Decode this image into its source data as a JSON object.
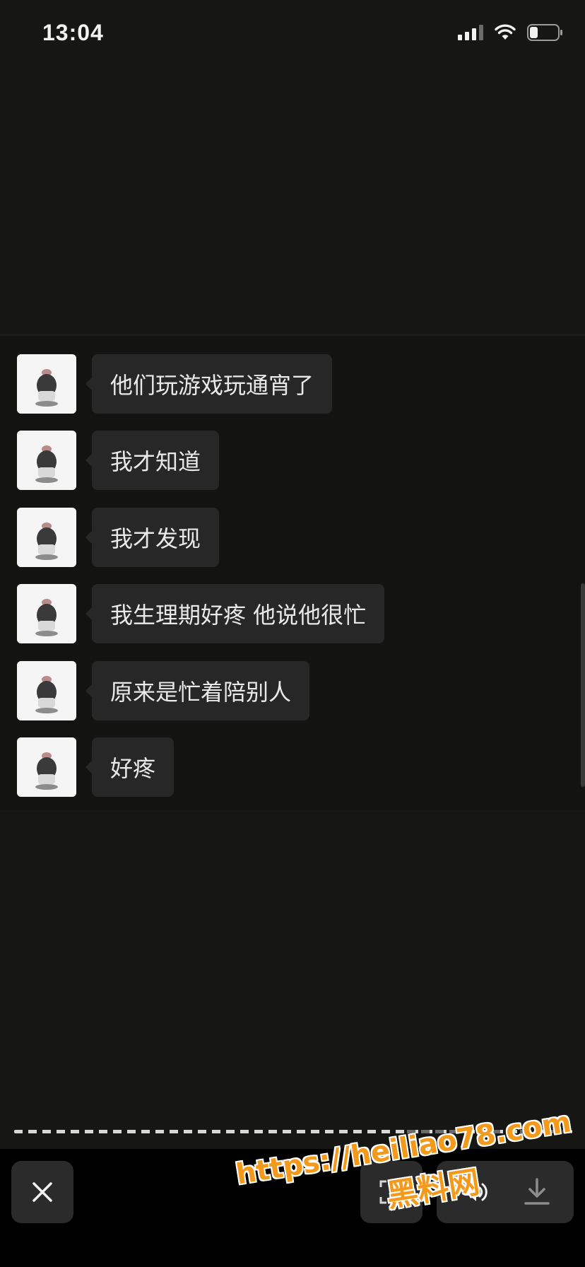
{
  "status_bar": {
    "time": "13:04"
  },
  "messages": [
    {
      "text": "他们玩游戏玩通宵了"
    },
    {
      "text": "我才知道"
    },
    {
      "text": "我才发现"
    },
    {
      "text": "我生理期好疼 他说他很忙"
    },
    {
      "text": "原来是忙着陪别人"
    },
    {
      "text": "好疼"
    }
  ],
  "toolbar": {
    "close_icon": "close-icon",
    "scan_icon": "scan-icon",
    "sound_icon": "sound-icon",
    "download_icon": "download-icon"
  },
  "watermark": {
    "url": "https://heiliao78.com",
    "name": "黑料网"
  }
}
